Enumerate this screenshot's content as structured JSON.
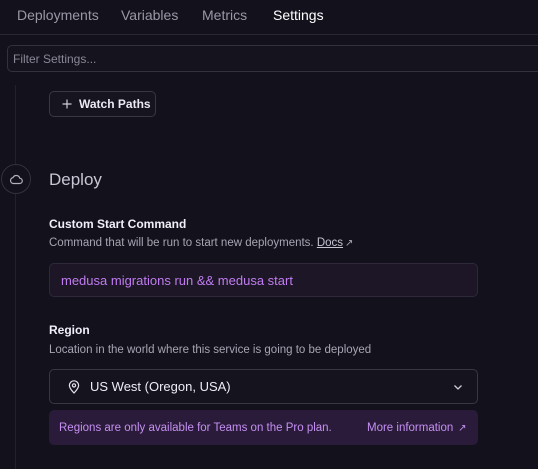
{
  "tabs": [
    {
      "label": "Deployments"
    },
    {
      "label": "Variables"
    },
    {
      "label": "Metrics"
    },
    {
      "label": "Settings",
      "active": true
    }
  ],
  "filter": {
    "placeholder": "Filter Settings..."
  },
  "watch_paths": {
    "label": "Watch Paths",
    "icon": "plus-icon"
  },
  "deploy": {
    "title": "Deploy",
    "icon": "cloud-icon",
    "custom_start": {
      "title": "Custom Start Command",
      "description": "Command that will be run to start new deployments.",
      "docs_label": "Docs",
      "value": "medusa migrations run && medusa start"
    },
    "region": {
      "title": "Region",
      "description": "Location in the world where this service is going to be deployed",
      "selected": "US West (Oregon, USA)",
      "icon": "map-pin-icon",
      "notice": "Regions are only available for Teams on the Pro plan.",
      "more_label": "More information"
    }
  },
  "colors": {
    "background": "#13111c",
    "accent_text": "#c07cf0",
    "notice_bg": "#2a1b3a"
  }
}
